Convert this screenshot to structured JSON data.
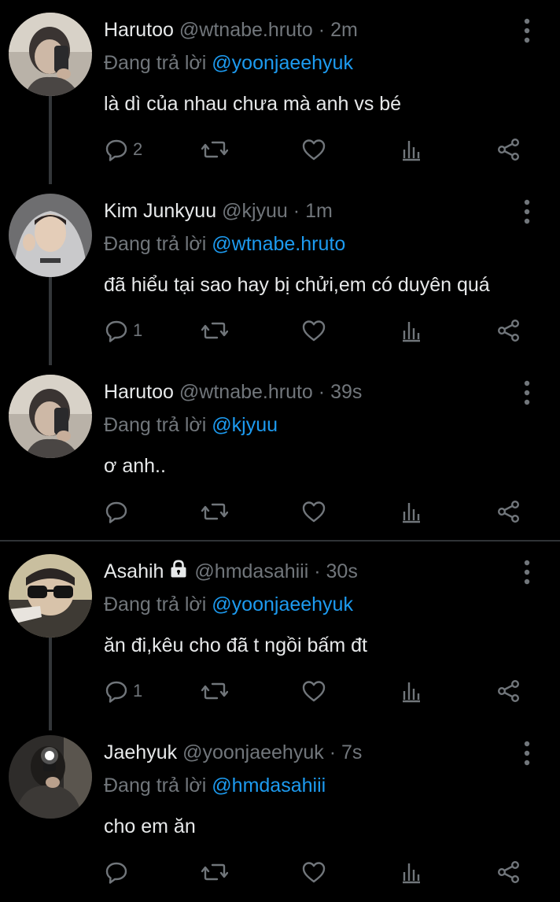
{
  "colors": {
    "background": "#000000",
    "name": "#e7e9ea",
    "muted": "#71767b",
    "link": "#1d9bf0",
    "divider": "#2f3336"
  },
  "replying_prefix": "Đang trả lời",
  "tweets": [
    {
      "name": "Harutoo",
      "handle": "@wtnabe.hruto",
      "sep": "·",
      "time": "2m",
      "replying_to": "@yoonjaeehyuk",
      "text": "là dì của nhau chưa mà anh vs bé",
      "reply_count": "2",
      "locked": false,
      "avatar_icon": "harutoo-avatar"
    },
    {
      "name": "Kim Junkyuu",
      "handle": "@kjyuu",
      "sep": "·",
      "time": "1m",
      "replying_to": "@wtnabe.hruto",
      "text": "đã hiểu tại sao hay bị chửi,em có duyên quá",
      "reply_count": "1",
      "locked": false,
      "avatar_icon": "junkyuu-avatar"
    },
    {
      "name": "Harutoo",
      "handle": "@wtnabe.hruto",
      "sep": "·",
      "time": "39s",
      "replying_to": "@kjyuu",
      "text": "ơ anh..",
      "reply_count": "",
      "locked": false,
      "avatar_icon": "harutoo-avatar"
    },
    {
      "name": "Asahih",
      "handle": "@hmdasahiii",
      "sep": "·",
      "time": "30s",
      "replying_to": "@yoonjaeehyuk",
      "text": "ăn đi,kêu cho đã t ngồi bấm đt",
      "reply_count": "1",
      "locked": true,
      "avatar_icon": "asahih-avatar"
    },
    {
      "name": "Jaehyuk",
      "handle": "@yoonjaeehyuk",
      "sep": "·",
      "time": "7s",
      "replying_to": "@hmdasahiii",
      "text": "cho em ăn",
      "reply_count": "",
      "locked": false,
      "avatar_icon": "jaehyuk-avatar"
    }
  ],
  "icons": {
    "reply": "reply-icon",
    "retweet": "retweet-icon",
    "like": "heart-icon",
    "views": "views-icon",
    "share": "share-icon",
    "more": "more-vertical-icon",
    "lock": "lock-icon"
  }
}
